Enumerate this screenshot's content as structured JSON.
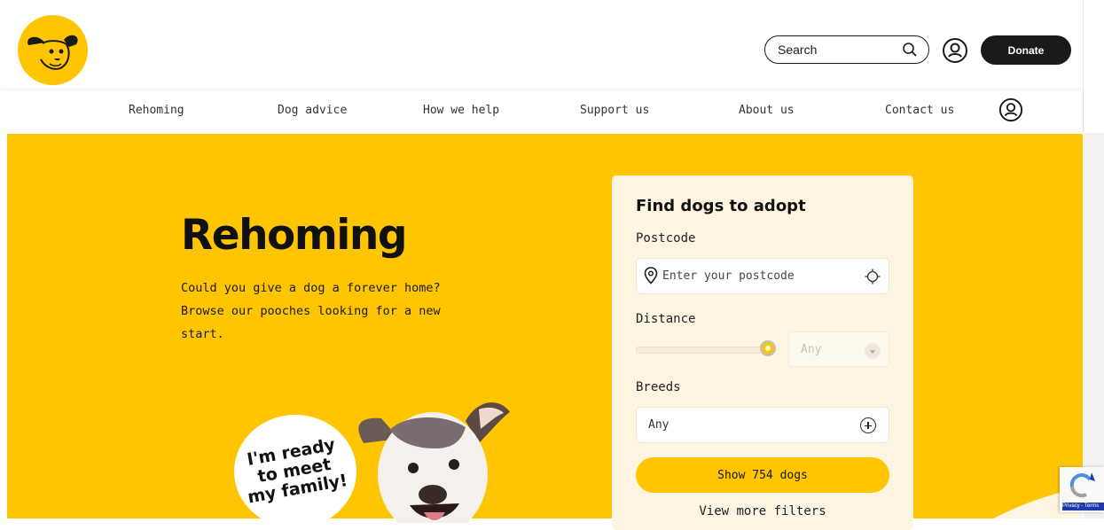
{
  "header": {
    "search_label": "Search",
    "donate_label": "Donate"
  },
  "nav": {
    "items": [
      {
        "label": "Rehoming"
      },
      {
        "label": "Dog advice"
      },
      {
        "label": "How we help"
      },
      {
        "label": "Support us"
      },
      {
        "label": "About us"
      },
      {
        "label": "Contact us"
      }
    ]
  },
  "hero": {
    "title": "Rehoming",
    "description": "Could you give a dog a forever home? Browse our pooches looking for a new start.",
    "bubble_text": "I'm ready to meet my family!"
  },
  "finder": {
    "title": "Find dogs to adopt",
    "postcode_label": "Postcode",
    "postcode_placeholder": "Enter your postcode",
    "distance_label": "Distance",
    "distance_value": "Any",
    "breeds_label": "Breeds",
    "breeds_value": "Any",
    "show_button": "Show 754 dogs",
    "more_filters": "View more filters"
  },
  "recaptcha": {
    "links": "Privacy - Terms"
  },
  "colors": {
    "brand_yellow": "#ffc500",
    "card_bg": "#fdf5e2",
    "dark": "#1a1a1a"
  }
}
